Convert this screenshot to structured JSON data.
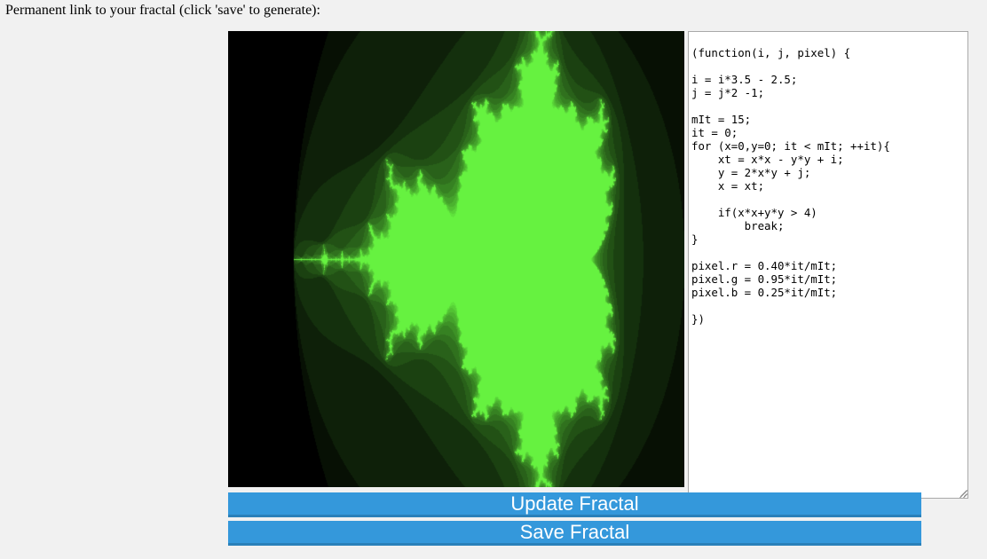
{
  "permalink": {
    "label": "Permanent link to your fractal (click 'save' to generate):"
  },
  "editor": {
    "code": "(function(i, j, pixel) {\n\ni = i*3.5 - 2.5;\nj = j*2 -1;\n\nmIt = 15;\nit = 0;\nfor (x=0,y=0; it < mIt; ++it){\n    xt = x*x - y*y + i;\n    y = 2*x*y + j;\n    x = xt;\n\n    if(x*x+y*y > 4)\n        break;\n}\n\npixel.r = 0.40*it/mIt;\npixel.g = 0.95*it/mIt;\npixel.b = 0.25*it/mIt;\n\n})"
  },
  "fractal": {
    "max_iterations": 15,
    "color_factors": {
      "r": 0.4,
      "g": 0.95,
      "b": 0.25
    },
    "i_scale": 3.5,
    "i_offset": -2.5,
    "j_scale": 2,
    "j_offset": -1
  },
  "buttons": {
    "update_label": "Update Fractal",
    "save_label": "Save Fractal"
  },
  "colors": {
    "button_bg": "#3498db",
    "button_border": "#2a80b9",
    "page_bg": "#f1f1f1"
  }
}
